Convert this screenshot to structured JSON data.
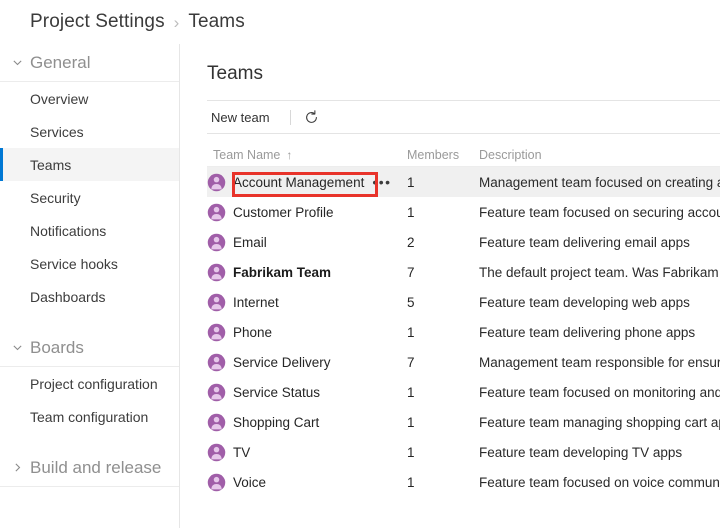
{
  "breadcrumb": {
    "root": "Project Settings",
    "separator": "›",
    "current": "Teams"
  },
  "sidebar": {
    "groups": [
      {
        "label": "General",
        "expanded": true,
        "chevron": "chevron-down-icon",
        "items": [
          {
            "label": "Overview",
            "selected": false
          },
          {
            "label": "Services",
            "selected": false
          },
          {
            "label": "Teams",
            "selected": true
          },
          {
            "label": "Security",
            "selected": false
          },
          {
            "label": "Notifications",
            "selected": false
          },
          {
            "label": "Service hooks",
            "selected": false
          },
          {
            "label": "Dashboards",
            "selected": false
          }
        ]
      },
      {
        "label": "Boards",
        "expanded": true,
        "chevron": "chevron-down-icon",
        "items": [
          {
            "label": "Project configuration",
            "selected": false
          },
          {
            "label": "Team configuration",
            "selected": false
          }
        ]
      },
      {
        "label": "Build and release",
        "expanded": false,
        "chevron": "chevron-right-icon",
        "items": []
      }
    ]
  },
  "main": {
    "title": "Teams",
    "toolbar": {
      "new_team_label": "New team",
      "refresh_icon": "refresh-icon"
    },
    "table": {
      "columns": [
        {
          "key": "name",
          "label": "Team Name",
          "sorted": true,
          "sort_direction": "ascending",
          "sort_glyph": "↑"
        },
        {
          "key": "members",
          "label": "Members"
        },
        {
          "key": "description",
          "label": "Description"
        }
      ],
      "rows": [
        {
          "name": "Account Management",
          "members": "1",
          "description": "Management team focused on creating and",
          "bold": false,
          "highlighted": true,
          "show_menu": true,
          "annotated": true
        },
        {
          "name": "Customer Profile",
          "members": "1",
          "description": "Feature team focused on securing account",
          "bold": false,
          "highlighted": false,
          "show_menu": false,
          "annotated": false
        },
        {
          "name": "Email",
          "members": "2",
          "description": "Feature team delivering email apps",
          "bold": false,
          "highlighted": false,
          "show_menu": false,
          "annotated": false
        },
        {
          "name": "Fabrikam Team",
          "members": "7",
          "description": "The default project team. Was Fabrikam Fi",
          "bold": true,
          "highlighted": false,
          "show_menu": false,
          "annotated": false
        },
        {
          "name": "Internet",
          "members": "5",
          "description": "Feature team developing web apps",
          "bold": false,
          "highlighted": false,
          "show_menu": false,
          "annotated": false
        },
        {
          "name": "Phone",
          "members": "1",
          "description": "Feature team delivering phone apps",
          "bold": false,
          "highlighted": false,
          "show_menu": false,
          "annotated": false
        },
        {
          "name": "Service Delivery",
          "members": "7",
          "description": "Management team responsible for ensure",
          "bold": false,
          "highlighted": false,
          "show_menu": false,
          "annotated": false
        },
        {
          "name": "Service Status",
          "members": "1",
          "description": "Feature team focused on monitoring and",
          "bold": false,
          "highlighted": false,
          "show_menu": false,
          "annotated": false
        },
        {
          "name": "Shopping Cart",
          "members": "1",
          "description": "Feature team managing shopping cart app",
          "bold": false,
          "highlighted": false,
          "show_menu": false,
          "annotated": false
        },
        {
          "name": "TV",
          "members": "1",
          "description": "Feature team developing TV apps",
          "bold": false,
          "highlighted": false,
          "show_menu": false,
          "annotated": false
        },
        {
          "name": "Voice",
          "members": "1",
          "description": "Feature team focused on voice communic",
          "bold": false,
          "highlighted": false,
          "show_menu": false,
          "annotated": false
        }
      ],
      "row_menu_glyph": "•••"
    }
  },
  "annotation": {
    "color": "#e8332a",
    "target": "Account Management"
  },
  "colors": {
    "accent": "#0078d4",
    "annotation": "#e8332a",
    "avatar_fill": "#a05ea8",
    "avatar_inner": "#e3c3e8",
    "selected_row_bg": "#f0f0f0",
    "selected_nav_bg": "#f4f4f4"
  }
}
